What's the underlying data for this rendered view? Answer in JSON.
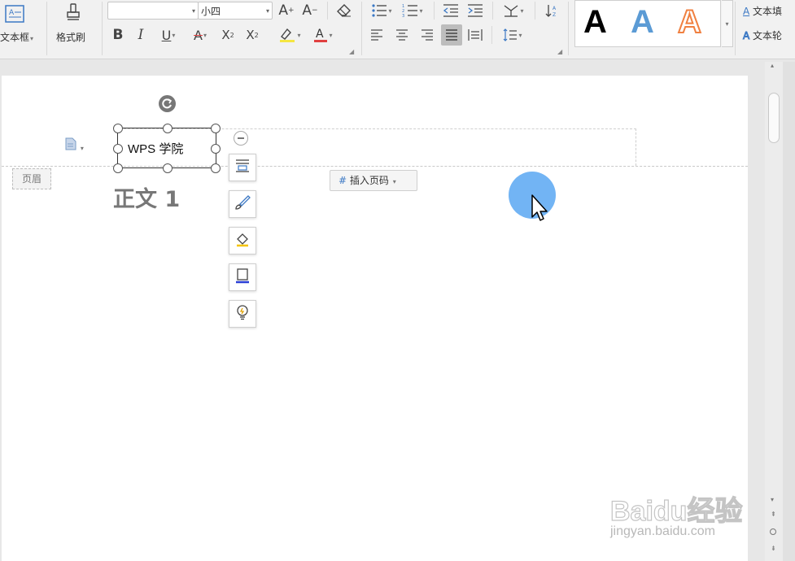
{
  "ribbon": {
    "textbox_label": "文本框",
    "format_painter_label": "格式刷",
    "font_name": "",
    "font_size": "小四",
    "text_fill_label": "文本填",
    "text_outline_label": "文本轮",
    "art_letters": [
      "A",
      "A",
      "A"
    ]
  },
  "document": {
    "header_tag": "页眉",
    "header_textbox_text": "WPS 学院",
    "insert_page_number_label": "插入页码",
    "body_heading": "正文 1"
  },
  "watermark": {
    "brand": "Baidu经验",
    "url": "jingyan.baidu.com"
  },
  "colors": {
    "art_black": "#000000",
    "art_blue": "#5b9bd5",
    "art_orange": "#f4a460",
    "cursor_highlight": "#6ab0f3",
    "highlight_yellow": "#f5e642",
    "font_color_red": "#e04040"
  }
}
